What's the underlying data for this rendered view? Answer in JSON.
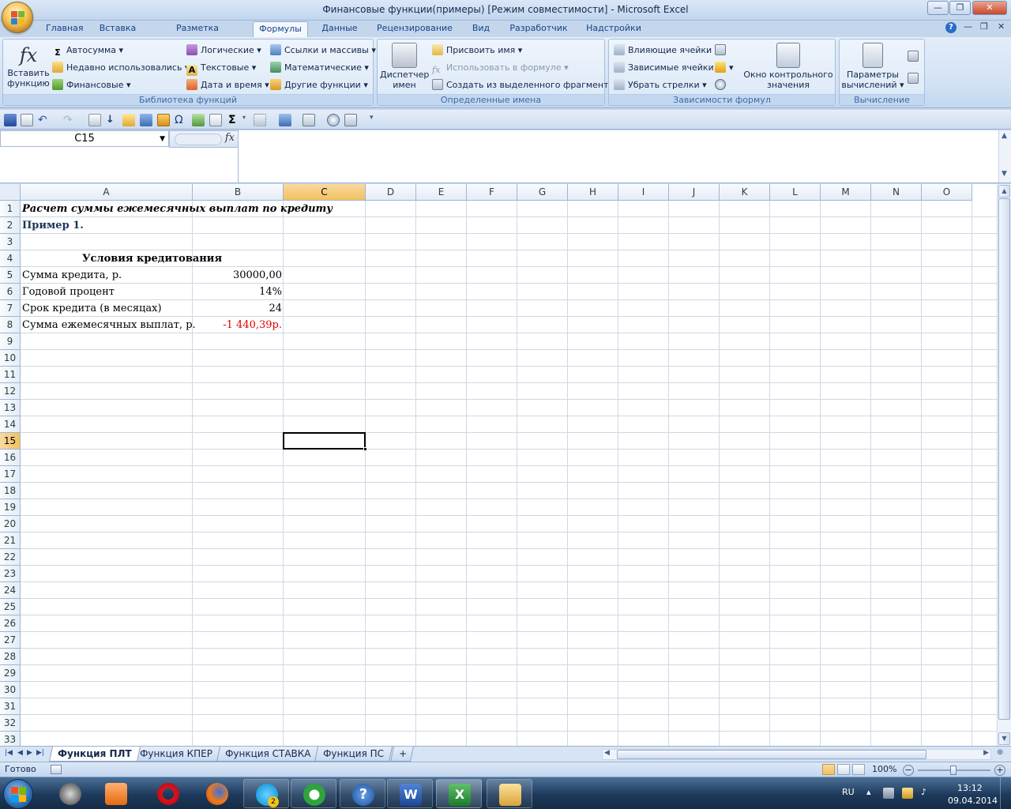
{
  "window": {
    "title": "Финансовые функции(примеры)  [Режим совместимости] - Microsoft Excel",
    "minimize": "—",
    "restore": "❐",
    "close": "✕"
  },
  "ribbon_tabs": [
    "Главная",
    "Вставка",
    "Разметка страницы",
    "Формулы",
    "Данные",
    "Рецензирование",
    "Вид",
    "Разработчик",
    "Надстройки"
  ],
  "active_tab": "Формулы",
  "ribbon": {
    "library": {
      "label": "Библиотека функций",
      "insert_function": "Вставить функцию",
      "insert_function_line1": "Вставить",
      "insert_function_line2": "функцию",
      "autosum": "Автосумма",
      "recent": "Недавно использовались",
      "financial": "Финансовые",
      "logical": "Логические",
      "text": "Текстовые",
      "datetime": "Дата и время",
      "lookup": "Ссылки и массивы",
      "math": "Математические",
      "other": "Другие функции"
    },
    "names": {
      "label": "Определенные имена",
      "manager_line1": "Диспетчер",
      "manager_line2": "имен",
      "define": "Присвоить имя",
      "use_in_formula": "Использовать в формуле",
      "create_from_selection": "Создать из выделенного фрагмента"
    },
    "auditing": {
      "label": "Зависимости формул",
      "precedents": "Влияющие ячейки",
      "dependents": "Зависимые ячейки",
      "remove_arrows": "Убрать стрелки",
      "watch_line1": "Окно контрольного",
      "watch_line2": "значения"
    },
    "calculation": {
      "label": "Вычисление",
      "options_line1": "Параметры",
      "options_line2": "вычислений"
    }
  },
  "formula_bar": {
    "name_box": "C15",
    "fx": "fx",
    "formula": ""
  },
  "columns": [
    "A",
    "B",
    "C",
    "D",
    "E",
    "F",
    "G",
    "H",
    "I",
    "J",
    "K",
    "L",
    "M",
    "N",
    "O"
  ],
  "selected_column": "C",
  "rows": [
    "1",
    "2",
    "3",
    "4",
    "5",
    "6",
    "7",
    "8",
    "9",
    "10",
    "11",
    "12",
    "13",
    "14",
    "15",
    "16",
    "17",
    "18",
    "19",
    "20",
    "21",
    "22",
    "23",
    "24",
    "25",
    "26",
    "27",
    "28",
    "29",
    "30",
    "31",
    "32",
    "33"
  ],
  "selected_row": "15",
  "cells": {
    "A1": "Расчет суммы ежемесячных выплат по кредиту",
    "A2": "Пример 1.",
    "A4": "Условия кредитования",
    "A5": "Сумма кредита, р.",
    "A6": "Годовой процент",
    "A7": "Срок кредита (в месяцах)",
    "A8": "Сумма ежемесячных выплат, р.",
    "B5": "30000,00",
    "B6": "14%",
    "B7": "24",
    "B8": "-1 440,39р."
  },
  "colors": {
    "example_heading": "#17365d",
    "negative_value": "#e00000",
    "selected_header": "#f1c15f"
  },
  "sheet_tabs": [
    "Функция ПЛТ",
    "Функция КПЕР",
    "Функция СТАВКА",
    "Функция ПС"
  ],
  "active_sheet": "Функция ПЛТ",
  "status": {
    "ready": "Готово",
    "zoom": "100%"
  },
  "taskbar": {
    "apps": [
      "media-player",
      "video-player",
      "opera",
      "firefox",
      "skype",
      "mail-agent",
      "help",
      "word",
      "excel",
      "explorer"
    ],
    "skype_badge": "2",
    "language": "RU",
    "time": "13:12",
    "date": "09.04.2014"
  }
}
